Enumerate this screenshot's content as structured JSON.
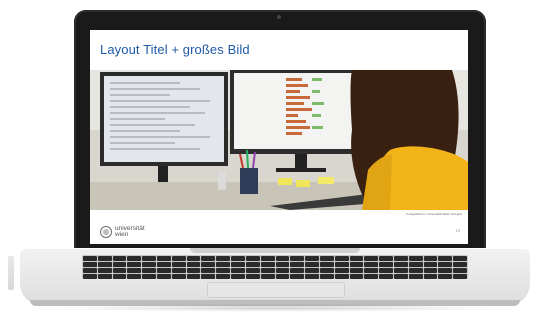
{
  "slide": {
    "title": "Layout Titel + großes Bild",
    "caption": "Fotograf/innen: Universität Wien/ Fotograf",
    "page_number": "19"
  },
  "logo": {
    "line1": "universität",
    "line2": "wien"
  },
  "colors": {
    "title": "#1f5aa6",
    "laptop_bezel": "#1a1a1a",
    "laptop_body": "#e6e6e6",
    "sweater": "#f2b418",
    "hair": "#3a2010"
  },
  "icons": [
    "university-seal-icon"
  ]
}
